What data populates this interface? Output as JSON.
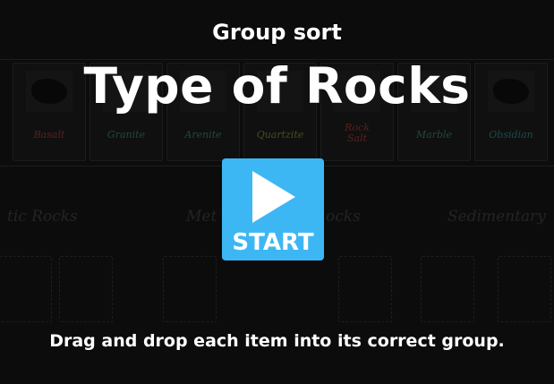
{
  "header": {
    "subtitle": "Group sort",
    "title": "Type of Rocks"
  },
  "start_button": {
    "label": "START",
    "icon": "play-icon",
    "color": "#3db7f4"
  },
  "instructions": "Drag and drop each item into its correct group.",
  "background": {
    "items": [
      {
        "label": "Basalt",
        "color": "#5a2020"
      },
      {
        "label": "Granite",
        "color": "#1f4a3a"
      },
      {
        "label": "Arenite",
        "color": "#1f4a3a"
      },
      {
        "label": "Quartzite",
        "color": "#4a4a20"
      },
      {
        "label": "Rock Salt",
        "color": "#5a2020"
      },
      {
        "label": "Marble",
        "color": "#1f4a3a"
      },
      {
        "label": "Obsidian",
        "color": "#1f4a4a"
      }
    ],
    "groups": [
      "tic Rocks",
      "Met",
      "ocks",
      "Sedimentary"
    ]
  }
}
